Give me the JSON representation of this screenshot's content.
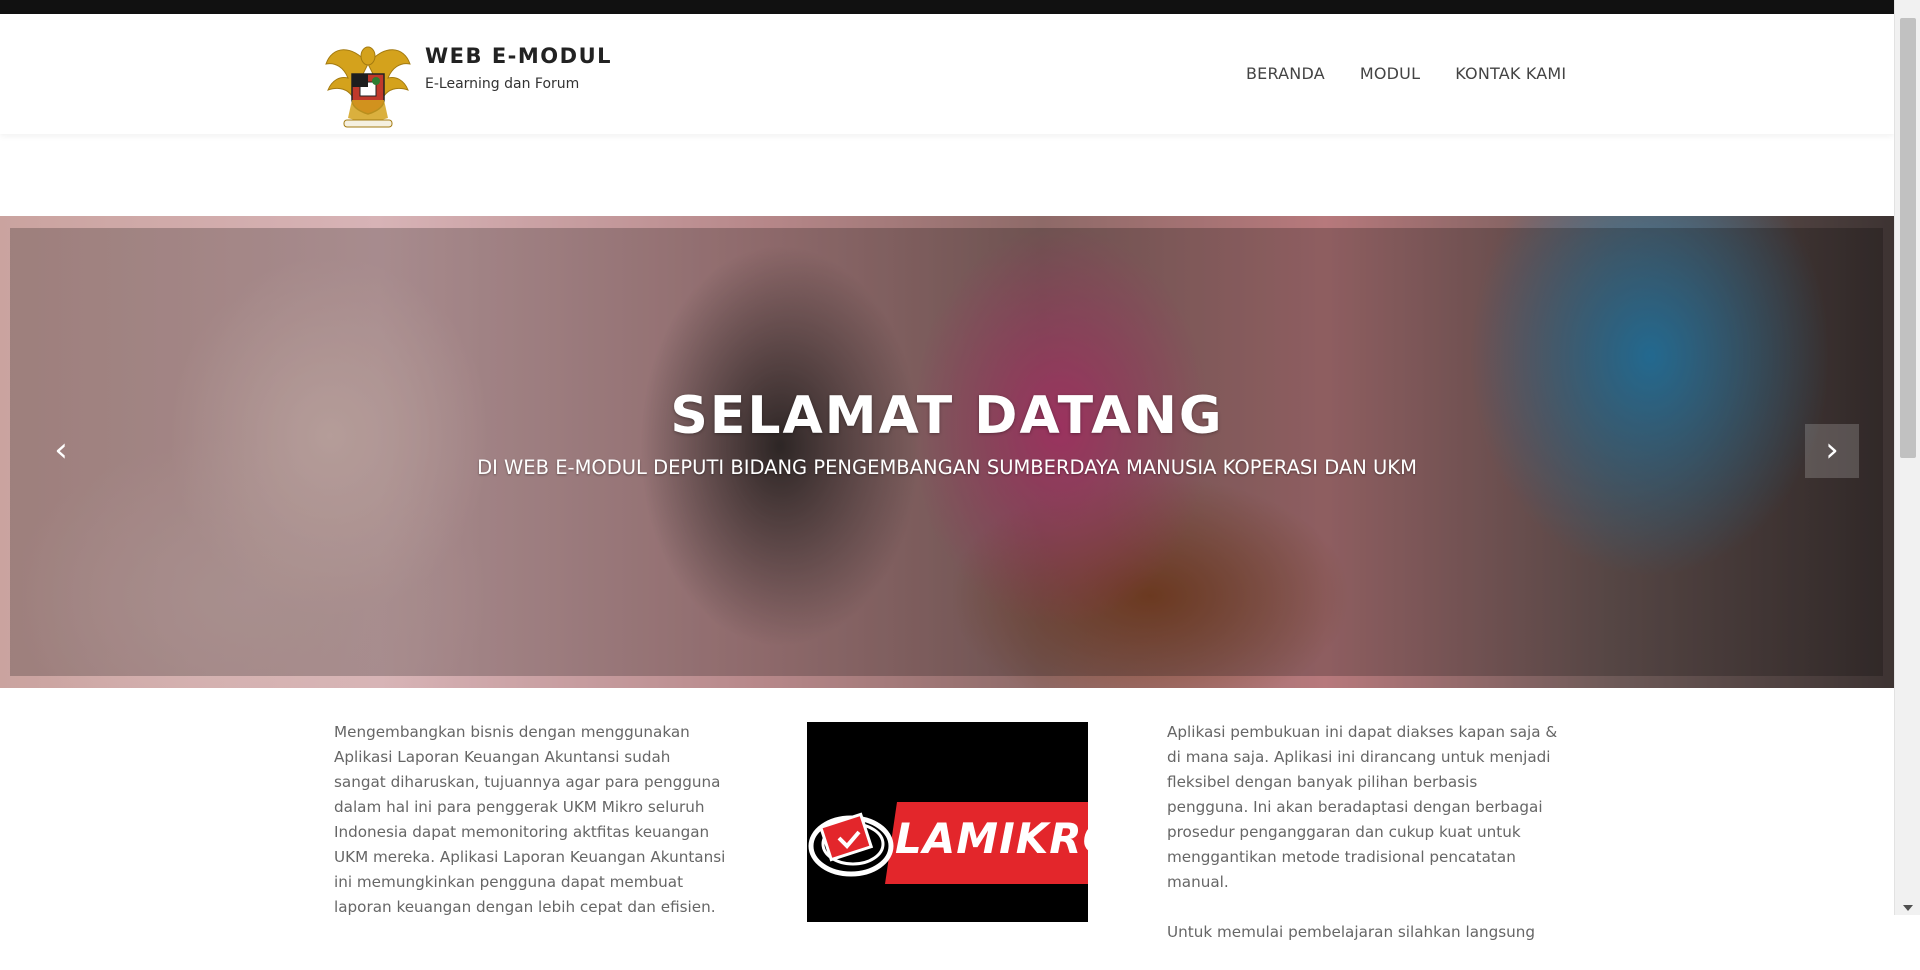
{
  "header": {
    "brand_title": "WEB E-MODUL",
    "brand_tagline": "E-Learning dan Forum",
    "logo_icon": "garuda-emblem-icon",
    "nav": [
      {
        "label": "BERANDA"
      },
      {
        "label": "MODUL"
      },
      {
        "label": "KONTAK KAMI"
      }
    ]
  },
  "hero": {
    "title": "SELAMAT DATANG",
    "subtitle": "DI WEB E-MODUL DEPUTI BIDANG PENGEMBANGAN SUMBERDAYA MANUSIA KOPERASI DAN UKM",
    "prev_icon": "chevron-left-icon",
    "next_icon": "chevron-right-icon",
    "prev_glyph": "‹",
    "next_glyph": "›"
  },
  "content": {
    "left_paragraph": "Mengembangkan bisnis dengan menggunakan Aplikasi Laporan Keuangan Akuntansi sudah sangat diharuskan, tujuannya agar para pengguna dalam hal ini para penggerak UKM Mikro seluruh Indonesia dapat memonitoring aktfitas keuangan UKM mereka. Aplikasi Laporan Keuangan Akuntansi ini memungkinkan pengguna dapat membuat laporan keuangan dengan lebih cepat dan efisien.",
    "lamikro_logo_text": "LAMIKRO",
    "right_paragraph_1": "Aplikasi pembukuan ini dapat diakses kapan saja & di mana saja. Aplikasi ini dirancang untuk menjadi fleksibel dengan banyak pilihan berbasis pengguna. Ini akan beradaptasi dengan berbagai prosedur penganggaran dan cukup kuat untuk menggantikan metode tradisional pencatatan manual.",
    "right_paragraph_2": "Untuk memulai pembelajaran silahkan langsung"
  },
  "colors": {
    "brand_text": "#222222",
    "nav_text": "#444444",
    "body_text": "#666666",
    "lamikro_red": "#e3262b"
  }
}
